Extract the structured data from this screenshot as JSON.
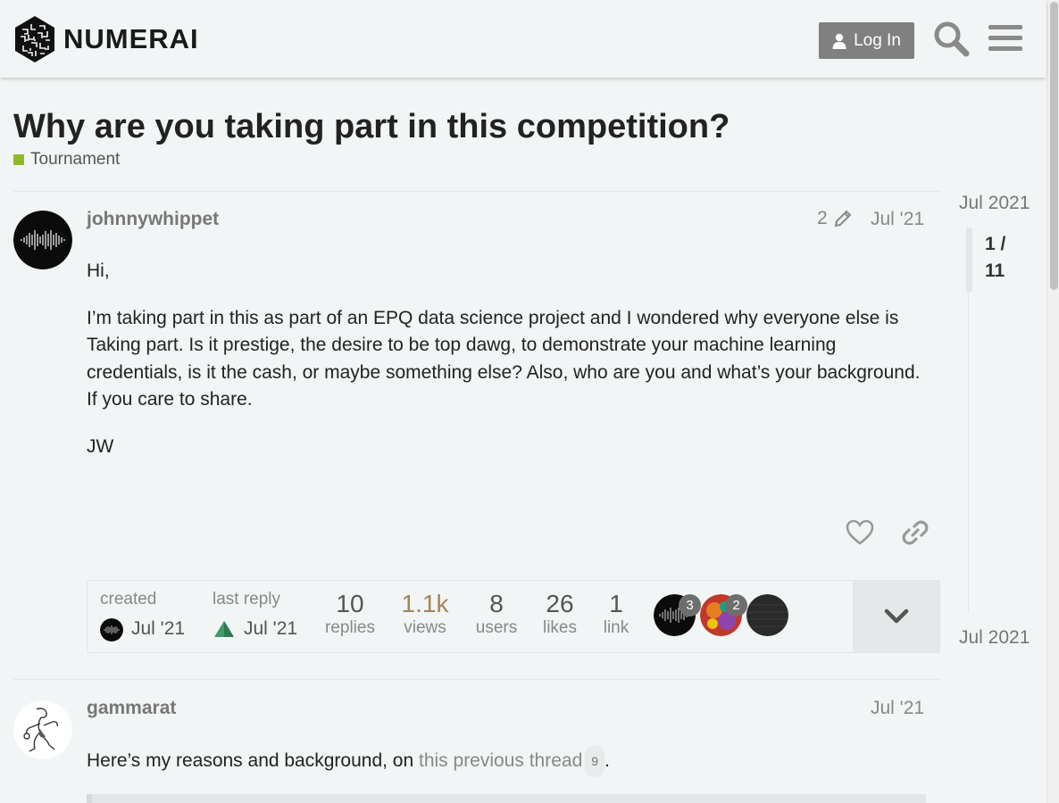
{
  "header": {
    "brand": "NUMERAI",
    "login_label": "Log In"
  },
  "topic": {
    "title": "Why are you taking part in this competition?",
    "category": "Tournament",
    "category_color": "#92b62c"
  },
  "posts": [
    {
      "username": "johnnywhippet",
      "date": "Jul '21",
      "edit_count": "2",
      "paragraphs": [
        "Hi,",
        "I’m taking part in this as part of an EPQ data science project and I wondered why everyone else is Taking part. Is it prestige, the desire to be top dawg, to demonstrate your machine learning credentials, is it the cash, or maybe something else? Also, who are you and what’s your background. If you care to share.",
        "JW"
      ]
    },
    {
      "username": "gammarat",
      "date": "Jul '21",
      "text_before": "Here’s my reasons and background, on ",
      "link_text": "this previous thread",
      "link_clicks": "9",
      "text_after": "."
    }
  ],
  "topic_map": {
    "created_label": "created",
    "created_date": "Jul '21",
    "last_reply_label": "last reply",
    "last_reply_date": "Jul '21",
    "stats": [
      {
        "num": "10",
        "label": "replies"
      },
      {
        "num": "1.1k",
        "label": "views"
      },
      {
        "num": "8",
        "label": "users"
      },
      {
        "num": "26",
        "label": "likes"
      },
      {
        "num": "1",
        "label": "link"
      }
    ],
    "participant_counts": [
      "3",
      "2"
    ]
  },
  "timeline": {
    "start_date": "Jul 2021",
    "position": "1 / 11",
    "end_date": "Jul 2021"
  }
}
